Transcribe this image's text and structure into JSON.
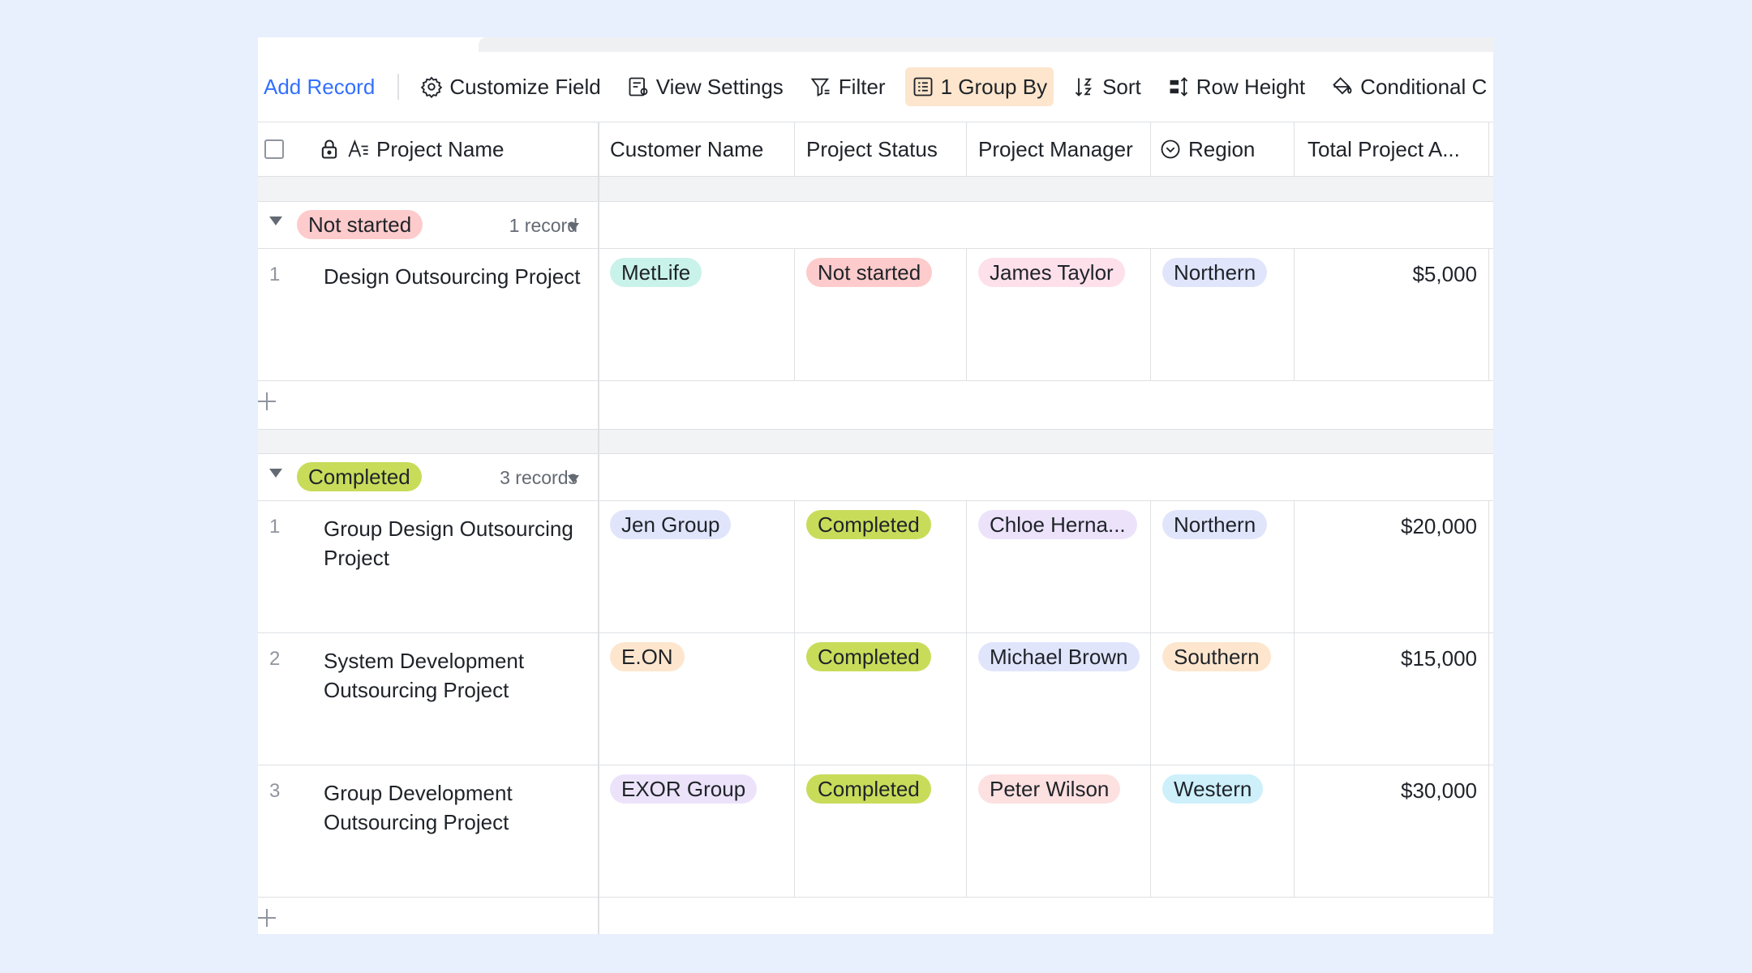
{
  "toolbar": {
    "add_record": "Add Record",
    "customize_field": "Customize Field",
    "view_settings": "View Settings",
    "filter": "Filter",
    "group_by": "1 Group By",
    "sort": "Sort",
    "row_height": "Row Height",
    "conditional": "Conditional C"
  },
  "columns": {
    "project_name": "Project Name",
    "customer_name": "Customer Name",
    "project_status": "Project Status",
    "project_manager": "Project Manager",
    "region": "Region",
    "total_amount": "Total Project A..."
  },
  "groups": [
    {
      "label": "Not started",
      "count": "1 record",
      "rows": [
        {
          "num": "1",
          "name": "Design Outsourcing Project",
          "customer": "MetLife",
          "status": "Not started",
          "manager": "James Taylor",
          "region": "Northern",
          "amount": "$5,000"
        }
      ]
    },
    {
      "label": "Completed",
      "count": "3 records",
      "rows": [
        {
          "num": "1",
          "name": "Group Design Outsourcing Project",
          "customer": "Jen Group",
          "status": "Completed",
          "manager": "Chloe Herna...",
          "region": "Northern",
          "amount": "$20,000"
        },
        {
          "num": "2",
          "name": "System Development Outsourcing Project",
          "customer": "E.ON",
          "status": "Completed",
          "manager": "Michael Brown",
          "region": "Southern",
          "amount": "$15,000"
        },
        {
          "num": "3",
          "name": "Group Development Outsourcing Project",
          "customer": "EXOR Group",
          "status": "Completed",
          "manager": "Peter Wilson",
          "region": "Western",
          "amount": "$30,000"
        }
      ]
    }
  ],
  "colors": {
    "accent": "#3370ff",
    "not_started_tag": "#fdcbcb",
    "completed_tag": "#c8dc5a",
    "group_by_active": "#fde6cd",
    "page_background": "#e8effd"
  }
}
